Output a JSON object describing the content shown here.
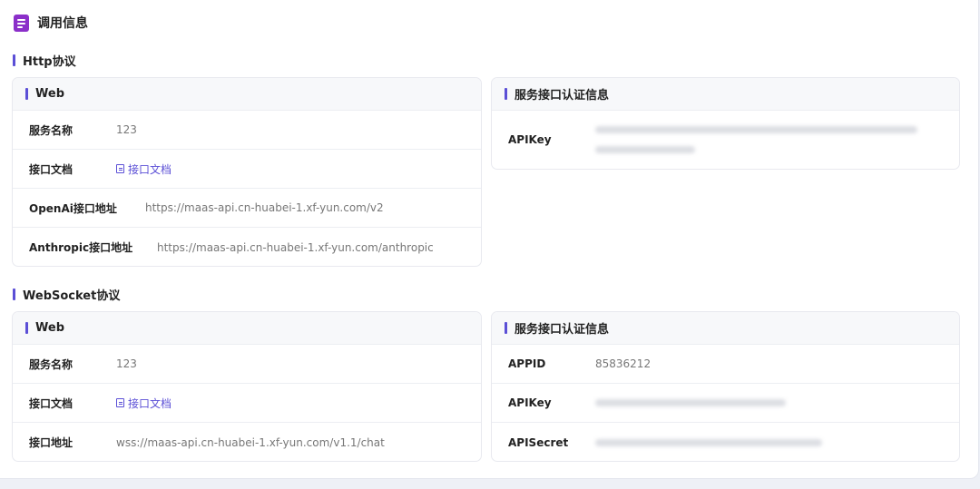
{
  "header": {
    "title": "调用信息",
    "icon": "document-icon"
  },
  "http": {
    "section_title": "Http协议",
    "web_card": {
      "title": "Web",
      "rows": [
        {
          "label": "服务名称",
          "value": "123"
        },
        {
          "label": "接口文档",
          "value": "接口文档"
        },
        {
          "label": "OpenAi接口地址",
          "value": "https://maas-api.cn-huabei-1.xf-yun.com/v2"
        },
        {
          "label": "Anthropic接口地址",
          "value": "https://maas-api.cn-huabei-1.xf-yun.com/anthropic"
        }
      ]
    },
    "auth_card": {
      "title": "服务接口认证信息",
      "rows": [
        {
          "label": "APIKey",
          "value": ""
        }
      ]
    }
  },
  "websocket": {
    "section_title": "WebSocket协议",
    "web_card": {
      "title": "Web",
      "rows": [
        {
          "label": "服务名称",
          "value": "123"
        },
        {
          "label": "接口文档",
          "value": "接口文档"
        },
        {
          "label": "接口地址",
          "value": "wss://maas-api.cn-huabei-1.xf-yun.com/v1.1/chat"
        }
      ]
    },
    "auth_card": {
      "title": "服务接口认证信息",
      "rows": [
        {
          "label": "APPID",
          "value": "85836212"
        },
        {
          "label": "APIKey",
          "value": ""
        },
        {
          "label": "APISecret",
          "value": ""
        }
      ]
    }
  },
  "colors": {
    "accent": "#5b4fd6",
    "icon": "#8b2fc9"
  }
}
